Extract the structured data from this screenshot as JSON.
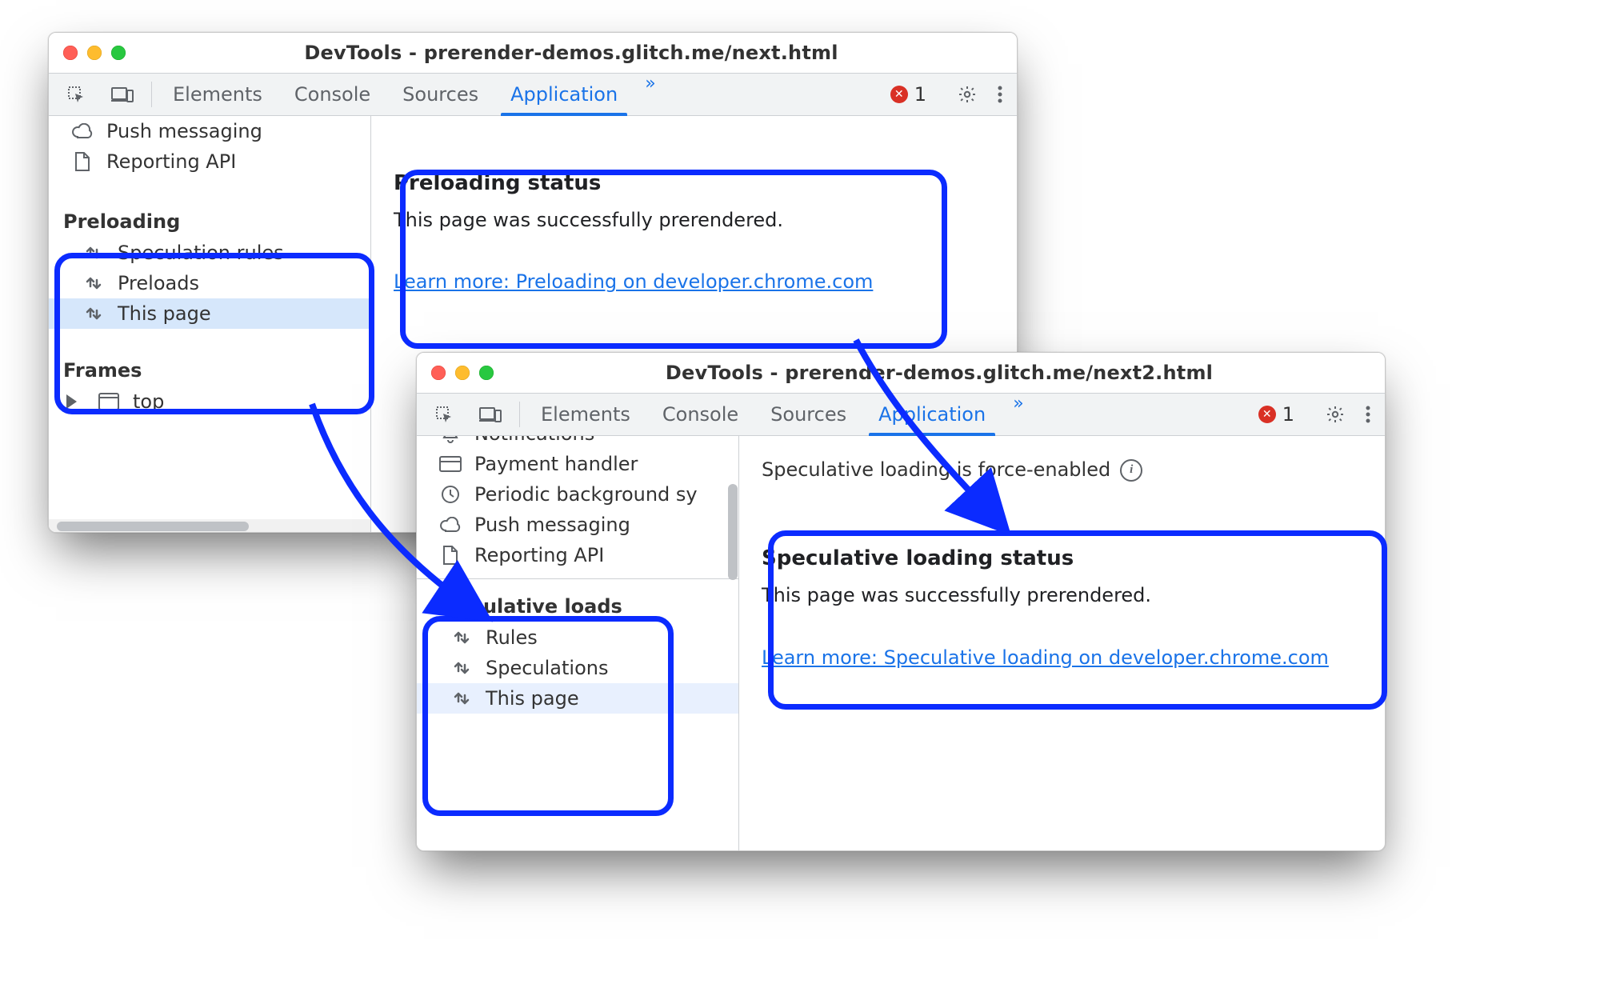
{
  "colors": {
    "accent": "#1a73e8",
    "highlight": "#0b2bff"
  },
  "win1": {
    "title": "DevTools - prerender-demos.glitch.me/next.html",
    "tabs": {
      "elements": "Elements",
      "console": "Console",
      "sources": "Sources",
      "application": "Application"
    },
    "overflow": "»",
    "errorCount": "1",
    "sidebar": {
      "bg_items": [
        {
          "icon": "cloud",
          "label": "Push messaging"
        },
        {
          "icon": "file",
          "label": "Reporting API"
        }
      ],
      "section": "Preloading",
      "items": [
        {
          "icon": "updown",
          "label": "Speculation rules",
          "selected": false
        },
        {
          "icon": "updown",
          "label": "Preloads",
          "selected": false
        },
        {
          "icon": "updown",
          "label": "This page",
          "selected": true
        }
      ],
      "frames_label": "Frames",
      "frames_top": "top"
    },
    "panel": {
      "heading": "Preloading status",
      "body": "This page was successfully prerendered.",
      "link": "Learn more: Preloading on developer.chrome.com"
    }
  },
  "win2": {
    "title": "DevTools - prerender-demos.glitch.me/next2.html",
    "tabs": {
      "elements": "Elements",
      "console": "Console",
      "sources": "Sources",
      "application": "Application"
    },
    "overflow": "»",
    "errorCount": "1",
    "sidebar": {
      "bg_items": [
        {
          "icon": "bell",
          "label": "Notifications"
        },
        {
          "icon": "card",
          "label": "Payment handler"
        },
        {
          "icon": "clock",
          "label": "Periodic background sy"
        },
        {
          "icon": "cloud",
          "label": "Push messaging"
        },
        {
          "icon": "file",
          "label": "Reporting API"
        }
      ],
      "section": "Speculative loads",
      "items": [
        {
          "icon": "updown",
          "label": "Rules",
          "selected": false
        },
        {
          "icon": "updown",
          "label": "Speculations",
          "selected": false
        },
        {
          "icon": "updown",
          "label": "This page",
          "selected": true
        }
      ]
    },
    "notice": "Speculative loading is force-enabled",
    "panel": {
      "heading": "Speculative loading status",
      "body": "This page was successfully prerendered.",
      "link": "Learn more: Speculative loading on developer.chrome.com"
    }
  }
}
